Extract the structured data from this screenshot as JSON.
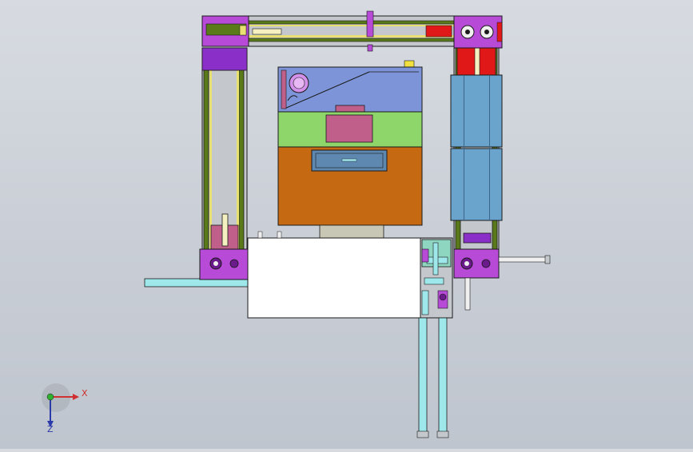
{
  "viewport": {
    "background_top": "#d7dbe1",
    "background_bottom": "#bfc5ce"
  },
  "colors": {
    "frame_purple": "#8a2fc8",
    "frame_magenta": "#b84ad8",
    "rail_green": "#5a7a1a",
    "rail_yellow": "#e8e070",
    "panel_blue": "#7d95d8",
    "panel_green": "#8ed66a",
    "panel_orange": "#c56a12",
    "cylinder_blue": "#6aa4cc",
    "red_block": "#e01818",
    "pink_block": "#c0608a",
    "cyan_leg": "#9ee8ec",
    "outline": "#1a1a1a",
    "white_plate": "#ffffff",
    "drawer_blue": "#5e88b0"
  },
  "triad": {
    "x_label": "X",
    "z_label": "Z",
    "x_color": "#d03030",
    "y_color": "#30b030",
    "z_color": "#2a3aa8"
  }
}
